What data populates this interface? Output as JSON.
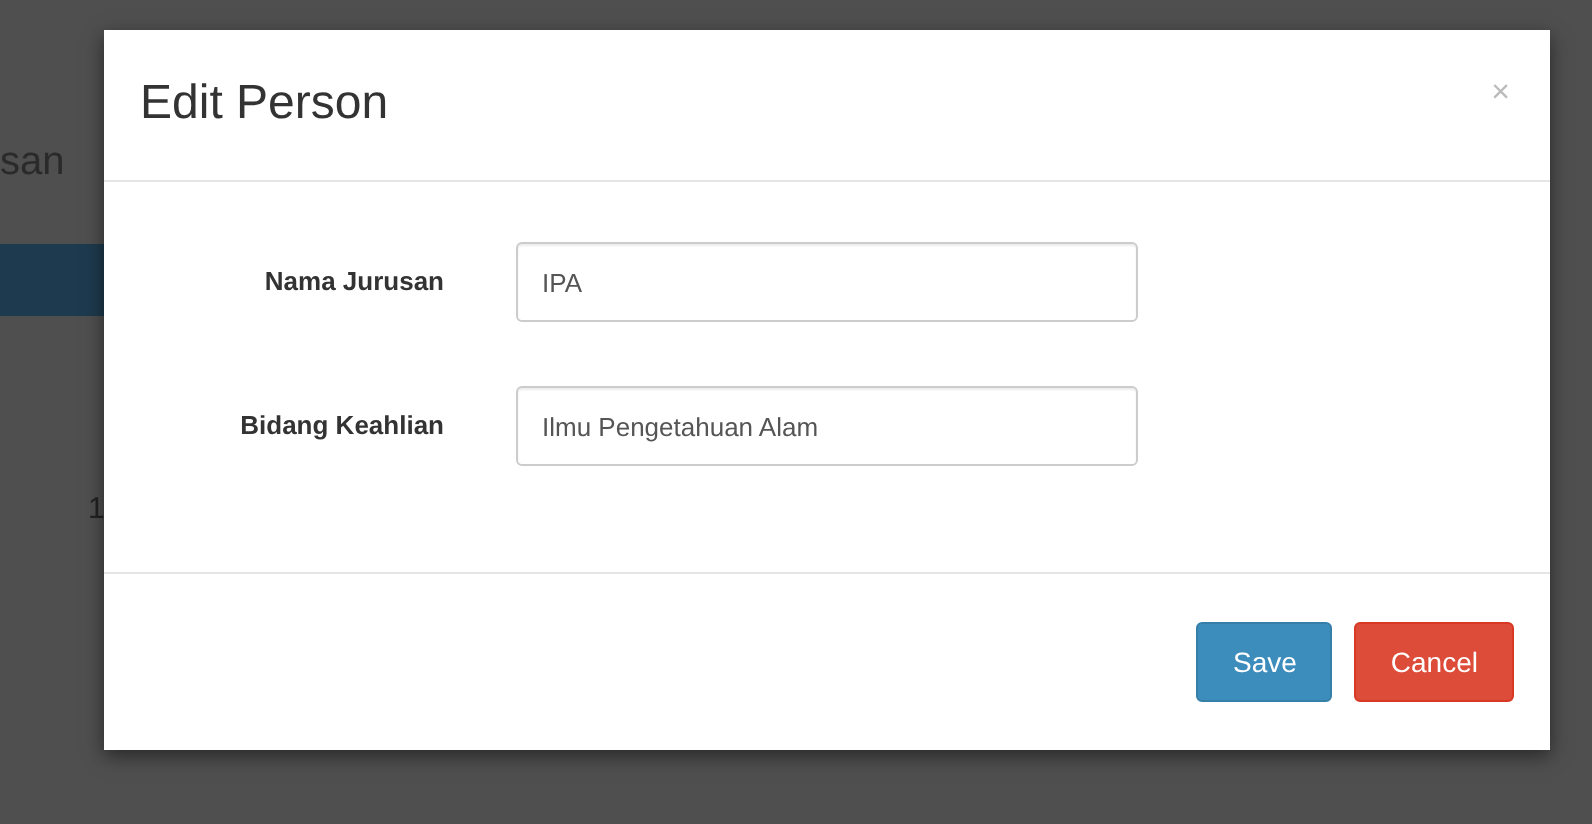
{
  "background": {
    "heading_fragment": "san",
    "cell_fragment": "1"
  },
  "modal": {
    "title": "Edit Person",
    "close": "×",
    "fields": [
      {
        "label": "Nama Jurusan",
        "value": "IPA"
      },
      {
        "label": "Bidang Keahlian",
        "value": "Ilmu Pengetahuan Alam"
      }
    ],
    "buttons": [
      {
        "label": "Save",
        "kind": "primary"
      },
      {
        "label": "Cancel",
        "kind": "danger"
      }
    ]
  }
}
